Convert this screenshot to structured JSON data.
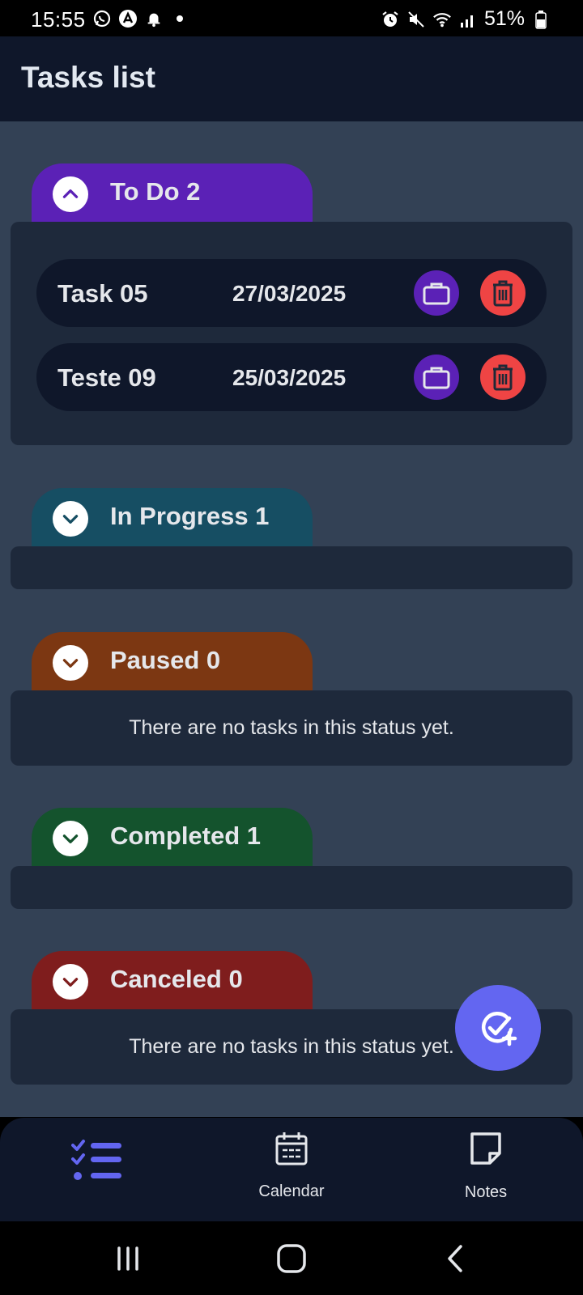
{
  "status_bar": {
    "time": "15:55",
    "battery": "51%"
  },
  "header": {
    "title": "Tasks list"
  },
  "sections": [
    {
      "label": "To Do 2",
      "color": "#5b21b6",
      "expanded": true,
      "empty_text": ""
    },
    {
      "label": "In Progress 1",
      "color": "#164e63",
      "expanded": false,
      "empty_text": ""
    },
    {
      "label": "Paused 0",
      "color": "#7c3712",
      "expanded": false,
      "empty_text": "There are no tasks in this status yet."
    },
    {
      "label": "Completed 1",
      "color": "#14532d",
      "expanded": false,
      "empty_text": ""
    },
    {
      "label": "Canceled 0",
      "color": "#7f1d1d",
      "expanded": false,
      "empty_text": "There are no tasks in this status yet."
    }
  ],
  "tasks": [
    {
      "name": "Task 05",
      "date": "27/03/2025"
    },
    {
      "name": "Teste 09",
      "date": "25/03/2025"
    }
  ],
  "fab": {
    "icon": "add-task-icon"
  },
  "bottom_nav": {
    "tasks": {
      "label": "",
      "icon": "task-list-icon",
      "active": true
    },
    "calendar": {
      "label": "Calendar",
      "icon": "calendar-icon"
    },
    "notes": {
      "label": "Notes",
      "icon": "note-icon"
    }
  },
  "colors": {
    "accent": "#6366f1",
    "delete": "#ef4444",
    "edit": "#5b21b6",
    "background": "#334155",
    "panel": "#1e293b",
    "header": "#0f172a"
  }
}
